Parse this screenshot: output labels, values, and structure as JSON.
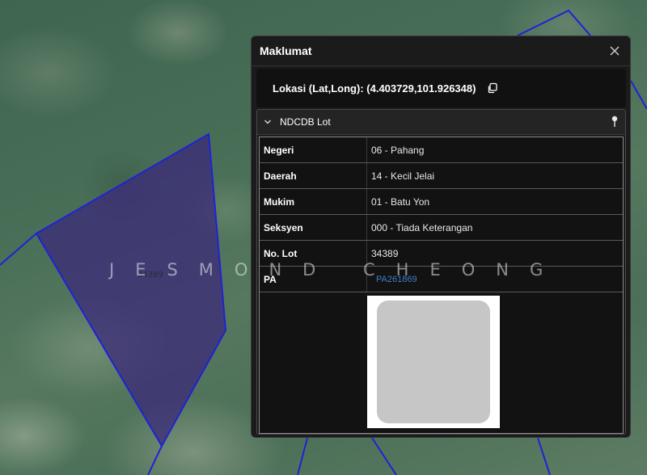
{
  "map": {
    "lot_label": "34389",
    "watermark": "JESMOND CHEONG",
    "colors": {
      "polygon_fill": "#3b2a7a",
      "polygon_stroke": "#2020d8"
    }
  },
  "panel": {
    "title": "Maklumat",
    "close_icon": "close-icon",
    "location_text": "Lokasi (Lat,Long): (4.403729,101.926348)",
    "copy_icon": "copy-icon",
    "section": {
      "label": "NDCDB Lot",
      "chevron_icon": "chevron-down-icon",
      "pin_icon": "pin-icon",
      "rows": [
        {
          "key": "Negeri",
          "value": "06 - Pahang"
        },
        {
          "key": "Daerah",
          "value": "14 - Kecil Jelai"
        },
        {
          "key": "Mukim",
          "value": "01 - Batu Yon"
        },
        {
          "key": "Seksyen",
          "value": "000 - Tiada Keterangan"
        },
        {
          "key": "No. Lot",
          "value": "34389"
        }
      ],
      "pa_key": "PA",
      "pa_link": "PA261869"
    }
  }
}
